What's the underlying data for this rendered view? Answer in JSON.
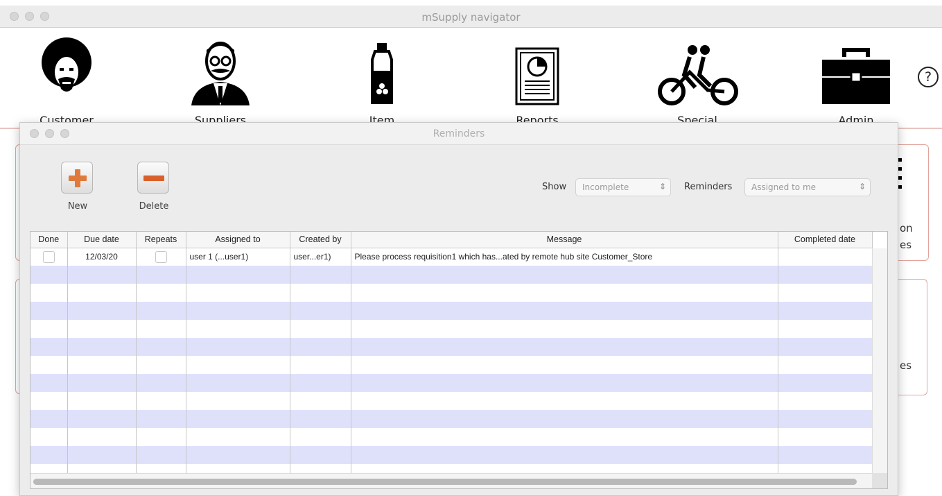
{
  "navigator": {
    "title": "mSupply navigator",
    "toolbar": [
      {
        "label": "Customer",
        "icon": "customer-icon"
      },
      {
        "label": "Suppliers",
        "icon": "suppliers-icon"
      },
      {
        "label": "Item",
        "icon": "item-bottle-icon"
      },
      {
        "label": "Reports",
        "icon": "reports-icon"
      },
      {
        "label": "Special",
        "icon": "tandem-bike-icon"
      },
      {
        "label": "Admin",
        "icon": "toolbox-icon"
      }
    ],
    "help": "?",
    "background_fragments": [
      "on",
      "es",
      "es"
    ]
  },
  "reminders": {
    "title": "Reminders",
    "new_label": "New",
    "delete_label": "Delete",
    "show_label": "Show",
    "show_value": "Incomplete",
    "reminders_label": "Reminders",
    "reminders_value": "Assigned to me",
    "columns": [
      "Done",
      "Due date",
      "Repeats",
      "Assigned to",
      "Created by",
      "Message",
      "Completed date"
    ],
    "rows": [
      {
        "due_date": "12/03/20",
        "assigned_to": "user 1 (...user1)",
        "created_by": "user...er1)",
        "message": "Please process requisition1 which has...ated by remote hub site Customer_Store",
        "completed_date": ""
      }
    ]
  },
  "colors": {
    "row_stripe": "#dfe1fb",
    "new_button_accent": "#e07a3c",
    "delete_button_accent": "#d9602a",
    "panel_border": "#e3a39b"
  }
}
